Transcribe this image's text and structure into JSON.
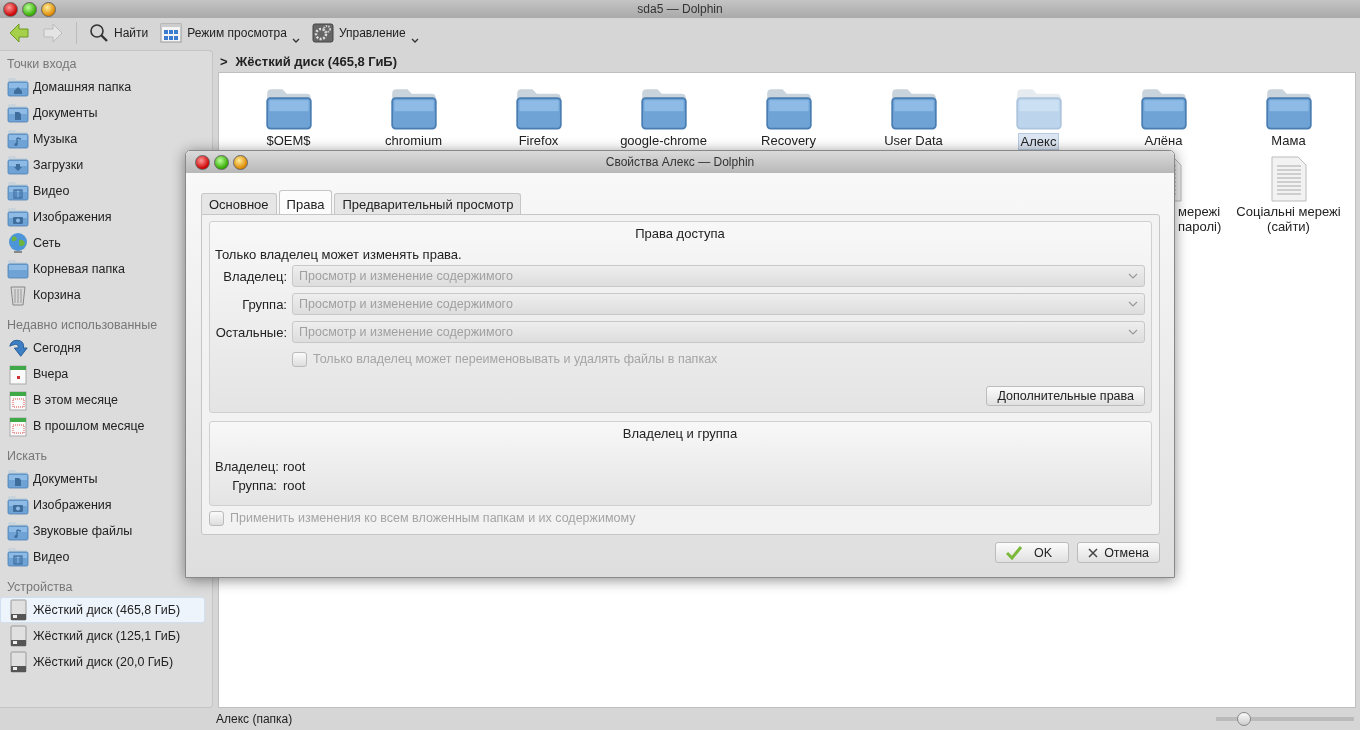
{
  "window": {
    "title": "sda5 — Dolphin"
  },
  "navigation": {
    "back_disabled": false,
    "forward_disabled": true
  },
  "toolbar": [
    {
      "kind": "search",
      "label": "Найти",
      "menu": false
    },
    {
      "kind": "view",
      "label": "Режим просмотра",
      "menu": true
    },
    {
      "kind": "manage",
      "label": "Управление",
      "menu": true
    }
  ],
  "sidebar": {
    "sections": [
      {
        "title": "Точки входа",
        "items": [
          {
            "kind": "home",
            "label": "Домашняя папка",
            "selected": false
          },
          {
            "kind": "documents",
            "label": "Документы",
            "selected": false
          },
          {
            "kind": "music",
            "label": "Музыка",
            "selected": false
          },
          {
            "kind": "downloads",
            "label": "Загрузки",
            "selected": false
          },
          {
            "kind": "video",
            "label": "Видео",
            "selected": false
          },
          {
            "kind": "pictures",
            "label": "Изображения",
            "selected": false
          },
          {
            "kind": "network",
            "label": "Сеть",
            "selected": false
          },
          {
            "kind": "folder",
            "label": "Корневая папка",
            "selected": false
          },
          {
            "kind": "trash",
            "label": "Корзина",
            "selected": false
          }
        ]
      },
      {
        "title": "Недавно использованные",
        "items": [
          {
            "kind": "today",
            "label": "Сегодня",
            "selected": false
          },
          {
            "kind": "yesterday",
            "label": "Вчера",
            "selected": false
          },
          {
            "kind": "calendar",
            "label": "В этом месяце",
            "selected": false
          },
          {
            "kind": "calendar",
            "label": "В прошлом месяце",
            "selected": false
          }
        ]
      },
      {
        "title": "Искать",
        "items": [
          {
            "kind": "documents",
            "label": "Документы",
            "selected": false
          },
          {
            "kind": "pictures",
            "label": "Изображения",
            "selected": false
          },
          {
            "kind": "music",
            "label": "Звуковые файлы",
            "selected": false
          },
          {
            "kind": "video",
            "label": "Видео",
            "selected": false
          }
        ]
      },
      {
        "title": "Устройства",
        "items": [
          {
            "kind": "disk",
            "label": "Жёсткий диск (465,8 ГиБ)",
            "selected": true
          },
          {
            "kind": "disk",
            "label": "Жёсткий диск (125,1 ГиБ)",
            "selected": false
          },
          {
            "kind": "disk",
            "label": "Жёсткий диск (20,0 ГиБ)",
            "selected": false
          }
        ]
      }
    ]
  },
  "breadcrumb": {
    "separator": ">",
    "location": "Жёсткий диск (465,8 ГиБ)"
  },
  "files": {
    "rows": [
      [
        {
          "kind": "folder",
          "name": "$OEM$",
          "selected": false
        },
        {
          "kind": "folder",
          "name": "chromium",
          "selected": false
        },
        {
          "kind": "folder",
          "name": "Firefox",
          "selected": false
        },
        {
          "kind": "folder",
          "name": "google-chrome",
          "selected": false
        },
        {
          "kind": "folder",
          "name": "Recovery",
          "selected": false
        },
        {
          "kind": "folder",
          "name": "User Data",
          "selected": false
        },
        {
          "kind": "folder",
          "name": "Алекс",
          "selected": true
        },
        {
          "kind": "folder",
          "name": "Алёна",
          "selected": false
        },
        {
          "kind": "folder",
          "name": "Мама",
          "selected": false
        }
      ],
      [
        "",
        "",
        "",
        "",
        "",
        "",
        "",
        {
          "kind": "partial",
          "name": "мережі паролі)",
          "selected": false
        },
        {
          "kind": "document",
          "name": "Соціальні мережі (сайти)",
          "selected": false
        }
      ]
    ]
  },
  "status_bar": {
    "text": "Алекс (папка)",
    "zoom": {
      "level": 0.2
    }
  },
  "dialog": {
    "title": "Свойства Алекс — Dolphin",
    "tabs": [
      {
        "label": "Основное",
        "selected": false
      },
      {
        "label": "Права",
        "selected": true
      },
      {
        "label": "Предварительный просмотр",
        "selected": false
      }
    ],
    "access": {
      "title": "Права доступа",
      "note": "Только владелец может изменять права.",
      "rows": [
        {
          "label": "Владелец:",
          "value": "Просмотр и изменение содержимого",
          "disabled": true
        },
        {
          "label": "Группа:",
          "value": "Просмотр и изменение содержимого",
          "disabled": true
        },
        {
          "label": "Остальные:",
          "value": "Просмотр и изменение содержимого",
          "disabled": true
        }
      ],
      "sticky": {
        "label": "Только владелец может переименовывать и удалять файлы в папках",
        "checked": false,
        "disabled": true
      },
      "advanced_button": "Дополнительные права"
    },
    "ownership": {
      "title": "Владелец и группа",
      "rows": [
        {
          "label": "Владелец:",
          "value": "root"
        },
        {
          "label": "Группа:",
          "value": "root"
        }
      ]
    },
    "recursive": {
      "label": "Применить изменения ко всем вложенным папкам и их содержимому",
      "checked": false,
      "disabled": true
    },
    "buttons": [
      {
        "kind": "ok",
        "label": "OK"
      },
      {
        "kind": "cancel",
        "label": "Отмена"
      }
    ]
  }
}
